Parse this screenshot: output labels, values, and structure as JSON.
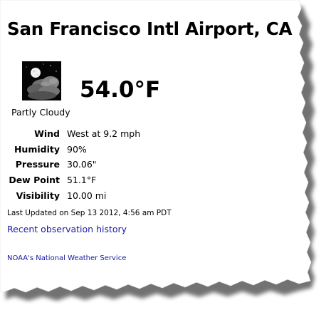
{
  "station": {
    "title": "San Francisco Intl Airport, CA"
  },
  "current": {
    "icon": "partly-cloudy-night-icon",
    "temperature": "54.0°F",
    "condition": "Partly Cloudy"
  },
  "observations": [
    {
      "label": "Wind",
      "value": "West at 9.2 mph"
    },
    {
      "label": "Humidity",
      "value": "90%"
    },
    {
      "label": "Pressure",
      "value": "30.06\""
    },
    {
      "label": "Dew Point",
      "value": "51.1°F"
    },
    {
      "label": "Visibility",
      "value": "10.00 mi"
    }
  ],
  "footer": {
    "last_updated": "Last Updated on Sep 13 2012, 4:56 am PDT",
    "history_link": "Recent observation history",
    "noaa_link": "NOAA's National Weather Service"
  },
  "colors": {
    "link": "#1a1aa6",
    "shadow": "#555555"
  }
}
